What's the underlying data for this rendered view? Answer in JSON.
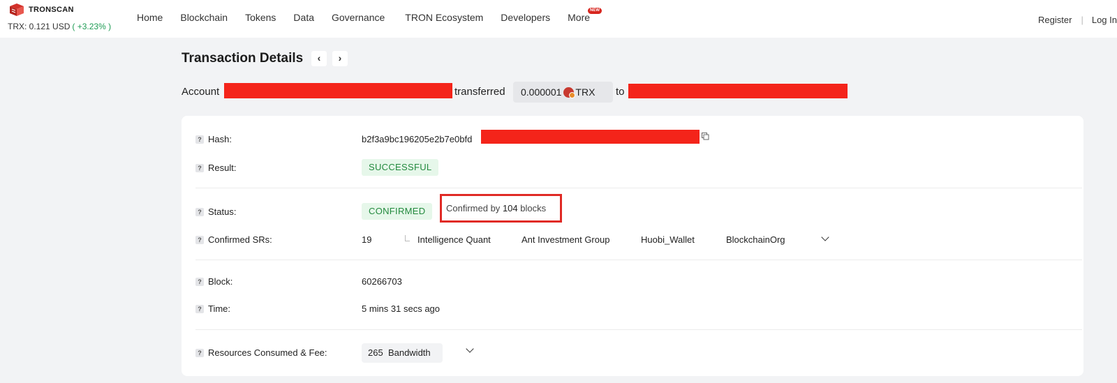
{
  "header": {
    "logo_text": "TRONSCAN",
    "price_label": "TRX: 0.121 USD",
    "price_change": "( +3.23% )",
    "nav": [
      "Home",
      "Blockchain",
      "Tokens",
      "Data",
      "Governance",
      "TRON Ecosystem",
      "Developers",
      "More"
    ],
    "new_badge": "NEW",
    "register": "Register",
    "separator": "|",
    "login": "Log In"
  },
  "page": {
    "title": "Transaction Details",
    "prev_arrow": "‹",
    "next_arrow": "›"
  },
  "summary": {
    "account_label": "Account",
    "transferred_label": "transferred",
    "amount": "0.000001",
    "token": "TRX",
    "to_label": "to"
  },
  "details": {
    "hash_label": "Hash:",
    "hash_value": "b2f3a9bc196205e2b7e0bfd",
    "result_label": "Result:",
    "result_value": "SUCCESSFUL",
    "status_label": "Status:",
    "status_value": "CONFIRMED",
    "confirmed_prefix": "Confirmed by",
    "confirmed_blocks": "104",
    "confirmed_suffix": "blocks",
    "srs_label": "Confirmed SRs:",
    "srs_count": "19",
    "srs": [
      "Intelligence Quant",
      "Ant Investment Group",
      "Huobi_Wallet",
      "BlockchainOrg"
    ],
    "block_label": "Block:",
    "block_value": "60266703",
    "time_label": "Time:",
    "time_value": "5 mins 31 secs ago",
    "resources_label": "Resources Consumed & Fee:",
    "bandwidth_amount": "265",
    "bandwidth_unit": "Bandwidth"
  },
  "colors": {
    "accent_red": "#e02a25",
    "success_green": "#238a3e",
    "change_green": "#1e9b54"
  }
}
